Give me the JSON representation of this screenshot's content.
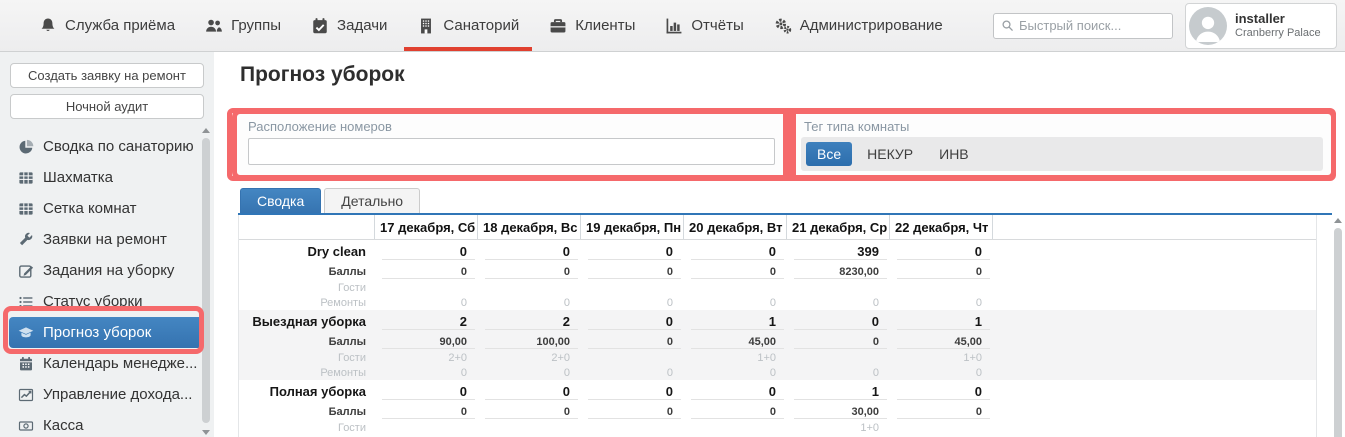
{
  "colors": {
    "accent_blue": "#3573b0",
    "nav_active_red": "#e0402f",
    "annotation_red": "#f5696b",
    "shaded_row_bg": "#f4f4f5"
  },
  "topnav": {
    "items": [
      {
        "label": "Служба приёма",
        "icon": "bell-icon",
        "active": false
      },
      {
        "label": "Группы",
        "icon": "users-icon",
        "active": false
      },
      {
        "label": "Задачи",
        "icon": "calendar-check-icon",
        "active": false
      },
      {
        "label": "Санаторий",
        "icon": "building-icon",
        "active": true
      },
      {
        "label": "Клиенты",
        "icon": "briefcase-icon",
        "active": false
      },
      {
        "label": "Отчёты",
        "icon": "bar-chart-icon",
        "active": false
      },
      {
        "label": "Администрирование",
        "icon": "gears-icon",
        "active": false
      }
    ]
  },
  "search": {
    "placeholder": "Быстрый поиск..."
  },
  "user": {
    "name": "installer",
    "org": "Cranberry Palace"
  },
  "sidebar": {
    "buttons": [
      {
        "label": "Создать заявку на ремонт"
      },
      {
        "label": "Ночной аудит"
      }
    ],
    "items": [
      {
        "label": "Сводка по санаторию",
        "icon": "pie-chart-icon",
        "active": false
      },
      {
        "label": "Шахматка",
        "icon": "grid-icon",
        "active": false
      },
      {
        "label": "Сетка комнат",
        "icon": "grid-icon",
        "active": false
      },
      {
        "label": "Заявки на ремонт",
        "icon": "wrench-icon",
        "active": false
      },
      {
        "label": "Задания на уборку",
        "icon": "edit-icon",
        "active": false
      },
      {
        "label": "Статус уборки",
        "icon": "list-icon",
        "active": false
      },
      {
        "label": "Прогноз уборок",
        "icon": "graduation-cap-icon",
        "active": true
      },
      {
        "label": "Календарь менедже...",
        "icon": "calendar-icon",
        "active": false
      },
      {
        "label": "Управление дохода...",
        "icon": "line-chart-icon",
        "active": false
      },
      {
        "label": "Касса",
        "icon": "cash-icon",
        "active": false
      }
    ]
  },
  "header": {
    "title": "Прогноз уборок"
  },
  "filters": {
    "location": {
      "label": "Расположение номеров",
      "value": ""
    },
    "room_tag": {
      "label": "Тег типа комнаты",
      "options": [
        {
          "label": "Все",
          "active": true
        },
        {
          "label": "НЕКУР",
          "active": false
        },
        {
          "label": "ИНВ",
          "active": false
        }
      ]
    }
  },
  "tabs": [
    {
      "label": "Сводка",
      "active": true
    },
    {
      "label": "Детально",
      "active": false
    }
  ],
  "table": {
    "columns": [
      "17 декабря, Сб",
      "18 декабря, Вс",
      "19 декабря, Пн",
      "20 декабря, Вт",
      "21 декабря, Ср",
      "22 декабря, Чт"
    ],
    "groups": [
      {
        "name": "Dry clean",
        "shaded": false,
        "values": [
          "0",
          "0",
          "0",
          "0",
          "399",
          "0"
        ],
        "subrows": [
          {
            "label": "Баллы",
            "emphasis": true,
            "values": [
              "0",
              "0",
              "0",
              "0",
              "8230,00",
              "0"
            ]
          },
          {
            "label": "Гости",
            "emphasis": false,
            "values": [
              "",
              "",
              "",
              "",
              "",
              ""
            ]
          },
          {
            "label": "Ремонты",
            "emphasis": false,
            "values": [
              "0",
              "0",
              "0",
              "0",
              "0",
              "0"
            ]
          }
        ]
      },
      {
        "name": "Выездная уборка",
        "shaded": true,
        "values": [
          "2",
          "2",
          "0",
          "1",
          "0",
          "1"
        ],
        "subrows": [
          {
            "label": "Баллы",
            "emphasis": true,
            "values": [
              "90,00",
              "100,00",
              "0",
              "45,00",
              "0",
              "45,00"
            ]
          },
          {
            "label": "Гости",
            "emphasis": false,
            "values": [
              "2+0",
              "2+0",
              "",
              "1+0",
              "",
              "1+0"
            ]
          },
          {
            "label": "Ремонты",
            "emphasis": false,
            "values": [
              "0",
              "0",
              "0",
              "0",
              "0",
              "0"
            ]
          }
        ]
      },
      {
        "name": "Полная уборка",
        "shaded": false,
        "values": [
          "0",
          "0",
          "0",
          "0",
          "1",
          "0"
        ],
        "subrows": [
          {
            "label": "Баллы",
            "emphasis": true,
            "values": [
              "0",
              "0",
              "0",
              "0",
              "30,00",
              "0"
            ]
          },
          {
            "label": "Гости",
            "emphasis": false,
            "values": [
              "",
              "",
              "",
              "",
              "1+0",
              ""
            ]
          }
        ]
      }
    ]
  }
}
